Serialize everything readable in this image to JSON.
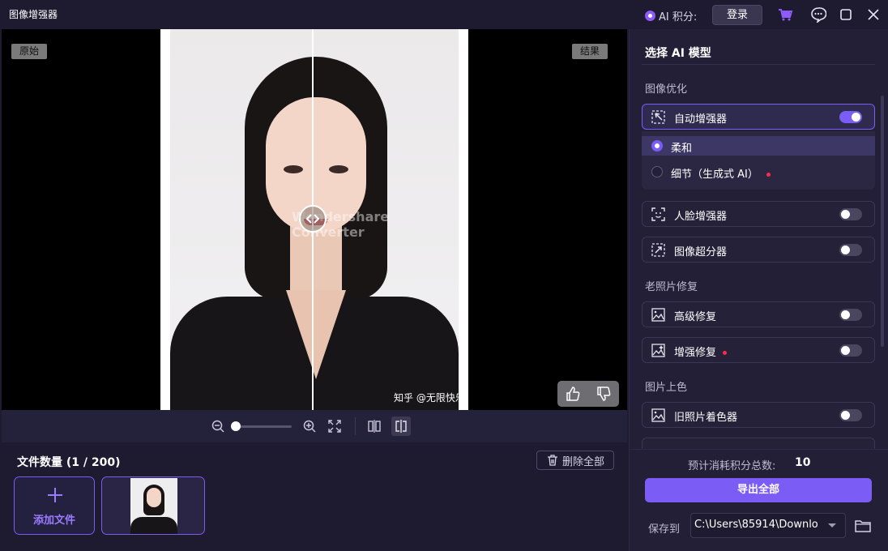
{
  "app": {
    "title": "图像增强器"
  },
  "titlebar": {
    "ai_points_label": "AI 积分:",
    "login_label": "登录"
  },
  "preview": {
    "original_badge": "原始",
    "result_badge": "结果",
    "watermark_text": "Wondershare Converter",
    "photo_caption": "知乎 @无限快乐"
  },
  "zoom": {
    "level": 0
  },
  "files": {
    "count_label": "文件数量 (1 / 200)",
    "delete_all_label": "删除全部",
    "add_file_label": "添加文件"
  },
  "panel": {
    "title": "选择 AI 模型",
    "sections": {
      "optimize": "图像优化",
      "old_photo": "老照片修复",
      "colorize": "图片上色"
    },
    "models": {
      "auto": {
        "label": "自动增强器",
        "enabled": true
      },
      "face": {
        "label": "人脸增强器",
        "enabled": false
      },
      "superres": {
        "label": "图像超分器",
        "enabled": false
      },
      "advanced_repair": {
        "label": "高级修复",
        "enabled": false
      },
      "enhanced_repair": {
        "label": "增强修复",
        "enabled": false
      },
      "colorizer": {
        "label": "旧照片着色器",
        "enabled": false
      }
    },
    "modes": [
      {
        "label": "柔和",
        "selected": true
      },
      {
        "label": "细节（生成式 AI）",
        "selected": false
      }
    ],
    "estimate_label": "预计消耗积分总数:",
    "estimate_value": "10",
    "export_label": "导出全部",
    "save_to_label": "保存到",
    "save_path": "C:\\Users\\85914\\Downlo"
  },
  "colors": {
    "accent": "#7b5cf5",
    "panel_bg": "#221f36",
    "app_bg": "#1e1b30",
    "new_dot": "#ff2b4a"
  }
}
